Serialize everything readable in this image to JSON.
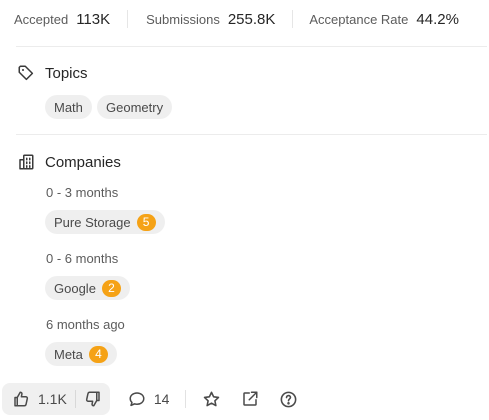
{
  "stats": [
    {
      "label": "Accepted",
      "value": "113K"
    },
    {
      "label": "Submissions",
      "value": "255.8K"
    },
    {
      "label": "Acceptance Rate",
      "value": "44.2%"
    }
  ],
  "topics": {
    "title": "Topics",
    "icon": "tag-icon",
    "tags": [
      "Math",
      "Geometry"
    ]
  },
  "companies": {
    "title": "Companies",
    "icon": "building-icon",
    "groups": [
      {
        "period": "0 - 3 months",
        "company": "Pure Storage",
        "count": "5"
      },
      {
        "period": "0 - 6 months",
        "company": "Google",
        "count": "2"
      },
      {
        "period": "6 months ago",
        "company": "Meta",
        "count": "4"
      }
    ]
  },
  "actions": {
    "likes": "1.1K",
    "comments": "14",
    "icons": [
      "thumbs-up-icon",
      "thumbs-down-icon",
      "comment-icon",
      "star-icon",
      "share-icon",
      "help-icon"
    ]
  },
  "colors": {
    "badge": "#f5a216",
    "chip_bg": "#efefef",
    "text": "#262626",
    "muted": "#5c5c5c"
  }
}
